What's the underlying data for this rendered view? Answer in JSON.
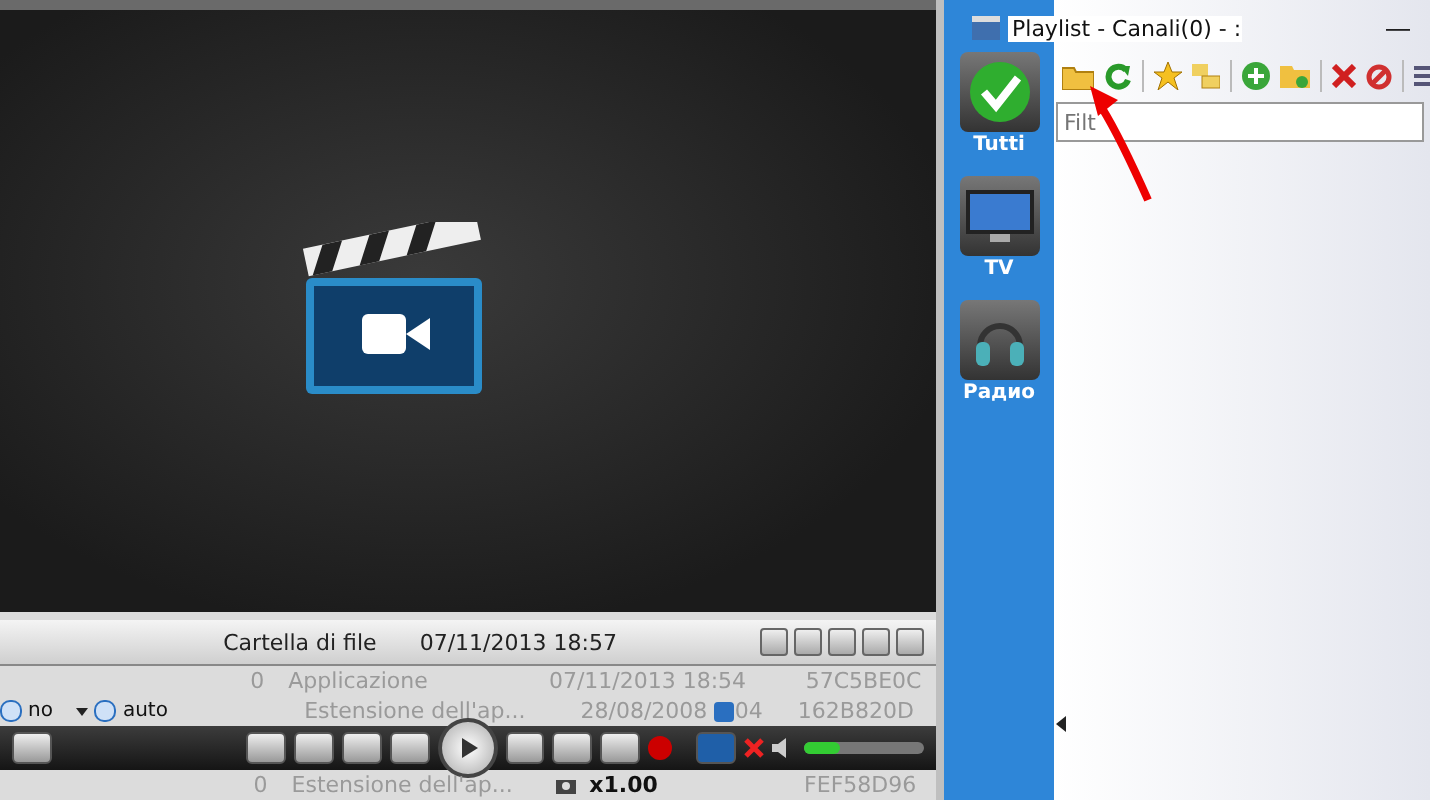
{
  "player": {
    "rows": [
      {
        "kind": "header",
        "name": "Cartella di file",
        "date": "07/11/2013 18:57"
      },
      {
        "kind": "plain",
        "num": "0",
        "name": "Applicazione",
        "date": "07/11/2013 18:54",
        "hash": "57C5BE0C"
      },
      {
        "kind": "options",
        "name": "Estensione dell'ap...",
        "date": "28/08/2008",
        "time_tail": "04",
        "hash": "162B820D"
      },
      {
        "kind": "transport"
      },
      {
        "kind": "speed",
        "num": "0",
        "name": "Estensione dell'ap...",
        "hash": "FEF58D96"
      }
    ],
    "aspect": "no",
    "zoom": "auto",
    "speed": "x1.00",
    "volume": {
      "level": 0.3
    }
  },
  "playlist": {
    "title": "Playlist - Canali(0) - :",
    "minimize": "—",
    "filter": {
      "placeholder": "Filt"
    },
    "categories": [
      {
        "kind": "all",
        "label": "Tutti"
      },
      {
        "kind": "tv",
        "label": "TV"
      },
      {
        "kind": "radio",
        "label": "Радио"
      }
    ]
  }
}
